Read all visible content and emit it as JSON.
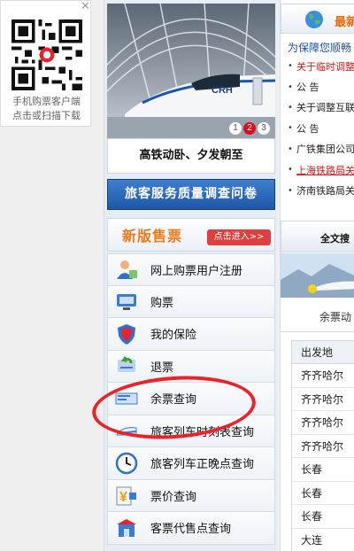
{
  "qr": {
    "close_icon": "close-icon",
    "caption_line1": "手机购票客户端",
    "caption_line2": "点击或扫描下载"
  },
  "banner": {
    "train_label": "CRH",
    "pager": [
      "1",
      "2",
      "3"
    ],
    "active_page": "2",
    "caption": "高铁动卧、夕发朝至"
  },
  "survey_button": "旅客服务质量调查问卷",
  "new_version": {
    "title": "新版售票",
    "enter_button": "点击进入>>"
  },
  "menu": {
    "items": [
      {
        "label": "网上购票用户注册",
        "icon": "user-register-icon"
      },
      {
        "label": "购票",
        "icon": "ticket-purchase-icon"
      },
      {
        "label": "我的保险",
        "icon": "insurance-shield-icon"
      },
      {
        "label": "退票",
        "icon": "refund-arrow-icon"
      },
      {
        "label": "余票查询",
        "icon": "ticket-query-icon"
      },
      {
        "label": "旅客列车时刻表查询",
        "icon": "train-timetable-icon"
      },
      {
        "label": "旅客列车正晚点查询",
        "icon": "clock-icon"
      },
      {
        "label": "票价查询",
        "icon": "fare-price-icon"
      },
      {
        "label": "客票代售点查询",
        "icon": "ticket-agency-icon"
      }
    ]
  },
  "news": {
    "title": "最新",
    "intro": "为保障您顺畅",
    "items": [
      {
        "text": "关于临时调整",
        "style": "red"
      },
      {
        "text": "公 告",
        "style": "black"
      },
      {
        "text": "关于调整互联",
        "style": "black"
      },
      {
        "text": "公 告",
        "style": "black"
      },
      {
        "text": "广铁集团公司",
        "style": "black"
      },
      {
        "text": "上海铁路局关",
        "style": "red underline"
      },
      {
        "text": "济南铁路局关",
        "style": "black"
      }
    ]
  },
  "search": {
    "title": "全文搜",
    "tab": "余票动",
    "table_header": "出发地",
    "rows": [
      "齐齐哈尔",
      "齐齐哈尔",
      "齐齐哈尔",
      "齐齐哈尔",
      "长春",
      "长春",
      "长春",
      "大连"
    ]
  },
  "colors": {
    "accent_blue": "#1d56a8",
    "orange": "#f07818",
    "red": "#e8232a"
  }
}
